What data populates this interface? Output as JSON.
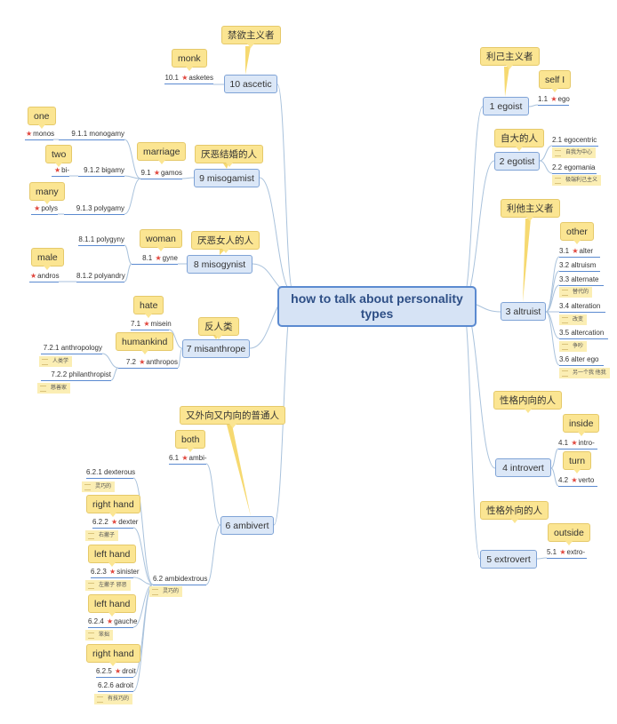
{
  "central": "how to talk about personality types",
  "colors": {
    "topic_fill": "#dbe7f7",
    "topic_border": "#7fa3d6",
    "callout_fill": "#fbe592",
    "star": "#e0453c",
    "line": "#a9c2dc",
    "underline": "#5b8ad0"
  },
  "b1": {
    "topic": "1 egoist",
    "meaning": "利己主义者",
    "roots": [
      {
        "callout": "self I",
        "label": "1.1",
        "text": "ego",
        "starred": true
      }
    ]
  },
  "b2": {
    "topic": "2 egotist",
    "meaning": "自大的人",
    "words": [
      {
        "label": "2.1",
        "text": "egocentric",
        "note": "自我为中心"
      },
      {
        "label": "2.2",
        "text": "egomania",
        "note": "极端利己主义"
      }
    ]
  },
  "b3": {
    "topic": "3 altruist",
    "meaning": "利他主义者",
    "words": [
      {
        "callout": "other",
        "label": "3.1",
        "text": "alter",
        "starred": true
      },
      {
        "label": "3.2",
        "text": "altruism"
      },
      {
        "label": "3.3",
        "text": "alternate",
        "note": "替代的"
      },
      {
        "label": "3.4",
        "text": "alteration",
        "note": "改变"
      },
      {
        "label": "3.5",
        "text": "altercation",
        "note": "争吵"
      },
      {
        "label": "3.6",
        "text": "alter ego",
        "note": "另一个我 他我"
      }
    ]
  },
  "b4": {
    "topic": "4 introvert",
    "meaning": "性格内向的人",
    "roots": [
      {
        "callout": "inside",
        "label": "4.1",
        "text": "intro-",
        "starred": true
      },
      {
        "callout": "turn",
        "label": "4.2",
        "text": "verto",
        "starred": true
      }
    ]
  },
  "b5": {
    "topic": "5 extrovert",
    "meaning": "性格外向的人",
    "roots": [
      {
        "callout": "outside",
        "label": "5.1",
        "text": "extro-",
        "starred": true
      }
    ]
  },
  "b6": {
    "topic": "6 ambivert",
    "meaning": "又外向又内向的普通人",
    "roots": [
      {
        "callout": "both",
        "label": "6.1",
        "text": "ambi-",
        "starred": true
      },
      {
        "label": "6.2",
        "text": "ambidextrous",
        "note": "灵巧的"
      }
    ],
    "words": [
      {
        "label": "6.2.1",
        "text": "dexterous",
        "note": "灵巧的"
      },
      {
        "callout": "right hand",
        "label": "6.2.2",
        "text": "dexter",
        "starred": true,
        "note": "右撇子"
      },
      {
        "callout": "left hand",
        "label": "6.2.3",
        "text": "sinister",
        "starred": true,
        "note": "左撇子 邪恶"
      },
      {
        "callout": "left hand",
        "label": "6.2.4",
        "text": "gauche",
        "starred": true,
        "note": "笨拙"
      },
      {
        "callout": "right hand",
        "label": "6.2.5",
        "text": "droit",
        "starred": true
      },
      {
        "label": "6.2.6",
        "text": "adroit",
        "note": "有技巧的"
      }
    ]
  },
  "b7": {
    "topic": "7 misanthrope",
    "meaning": "反人类",
    "roots": [
      {
        "callout": "hate",
        "label": "7.1",
        "text": "misein",
        "starred": true
      },
      {
        "callout": "humankind",
        "label": "7.2",
        "text": "anthropos",
        "starred": true
      }
    ],
    "words": [
      {
        "label": "7.2.1",
        "text": "anthropology",
        "note": "人类学"
      },
      {
        "label": "7.2.2",
        "text": "philanthropist",
        "note": "慈善家"
      }
    ]
  },
  "b8": {
    "topic": "8 misogynist",
    "meaning": "厌恶女人的人",
    "roots": [
      {
        "callout": "woman",
        "label": "8.1",
        "text": "gyne",
        "starred": true
      }
    ],
    "words": [
      {
        "label": "8.1.1",
        "text": "polygyny"
      },
      {
        "label": "8.1.2",
        "text": "polyandry"
      }
    ],
    "extra": [
      {
        "callout": "male",
        "label": "",
        "text": "andros",
        "starred": true
      }
    ]
  },
  "b9": {
    "topic": "9 misogamist",
    "meaning": "厌恶结婚的人",
    "roots": [
      {
        "callout": "marriage",
        "label": "9.1",
        "text": "gamos",
        "starred": true
      }
    ],
    "words": [
      {
        "label": "9.1.1",
        "text": "monogamy"
      },
      {
        "label": "9.1.2",
        "text": "bigamy"
      },
      {
        "label": "9.1.3",
        "text": "polygamy"
      }
    ],
    "extra": [
      {
        "callout": "one",
        "label": "",
        "text": "monos",
        "starred": true
      },
      {
        "callout": "two",
        "label": "",
        "text": "bi-",
        "starred": true
      },
      {
        "callout": "many",
        "label": "",
        "text": "polys",
        "starred": true
      }
    ]
  },
  "b10": {
    "topic": "10 ascetic",
    "meaning": "禁欲主义者",
    "roots": [
      {
        "callout": "monk",
        "label": "10.1",
        "text": "asketes",
        "starred": true
      }
    ]
  }
}
